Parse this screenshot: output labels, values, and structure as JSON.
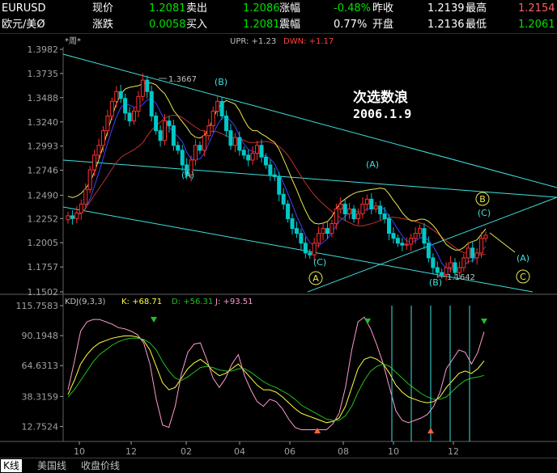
{
  "quote": {
    "symbol": "EURUSD",
    "name": "欧元/美Ø",
    "row1": [
      {
        "label": "现价",
        "value": "1.2081"
      },
      {
        "label": "卖出",
        "value": "1.2086"
      },
      {
        "label": "涨幅",
        "value": "-0.48%"
      },
      {
        "label": "昨收",
        "value": "1.2139"
      },
      {
        "label": "最高",
        "value": "1.2154"
      }
    ],
    "row2": [
      {
        "label": "涨跌",
        "value": "0.0058"
      },
      {
        "label": "买入",
        "value": "1.2081"
      },
      {
        "label": "震幅",
        "value": "0.77%"
      },
      {
        "label": "开盘",
        "value": "1.2136"
      },
      {
        "label": "最低",
        "value": "1.2061"
      }
    ]
  },
  "price_panel": {
    "indicator_text": "*周*",
    "upr_label": "UPR: +1.23",
    "dn_label": "DWN: +1.17",
    "y_ticks": [
      "1.3982",
      "1.3735",
      "1.3488",
      "1.3240",
      "1.2993",
      "1.2746",
      "1.2490",
      "1.2252",
      "1.2005",
      "1.1757",
      "1.1502"
    ],
    "high_note": "1.3667",
    "low_note": "1.1642",
    "title_cn": "次选数浪",
    "title_date": "2006.1.9",
    "waves": [
      "(B)",
      "(A)",
      "(A)",
      "(C)",
      "(C)",
      "(B)",
      "(A)",
      "A",
      "B",
      "C"
    ]
  },
  "kdj_panel": {
    "label": "KDJ(9,3,3)",
    "k_label": "K: +68.71",
    "d_label": "D: +56.31",
    "j_label": "J: +93.51",
    "y_ticks": [
      "115.7583",
      "90.1948",
      "64.6313",
      "38.3159",
      "12.7524"
    ]
  },
  "x_ticks": [
    "10",
    "12",
    "02",
    "04",
    "06",
    "08",
    "10",
    "12"
  ],
  "tabs": [
    "K线",
    "美国线",
    "收盘价线"
  ],
  "colors": {
    "up": "#ff3030",
    "down": "#00c8c8",
    "ma1": "#e8e850",
    "ma2": "#4040ff",
    "ma3": "#c03030",
    "trend": "#40e0e0",
    "k": "#ffff40",
    "d": "#20c020",
    "j": "#ff9ad0",
    "axis": "#a0a0a0"
  },
  "chart_data": [
    {
      "type": "candlestick",
      "title": "次选数浪 2006.1.9",
      "ylim": [
        1.1502,
        1.3982
      ],
      "closes": [
        1.228,
        1.2252,
        1.231,
        1.24,
        1.255,
        1.275,
        1.29,
        1.3,
        1.315,
        1.33,
        1.345,
        1.355,
        1.348,
        1.333,
        1.325,
        1.335,
        1.35,
        1.3667,
        1.355,
        1.33,
        1.315,
        1.305,
        1.325,
        1.32,
        1.3,
        1.295,
        1.28,
        1.27,
        1.285,
        1.3,
        1.295,
        1.31,
        1.32,
        1.335,
        1.345,
        1.33,
        1.315,
        1.3,
        1.308,
        1.295,
        1.29,
        1.285,
        1.292,
        1.3,
        1.288,
        1.28,
        1.27,
        1.268,
        1.25,
        1.24,
        1.225,
        1.215,
        1.21,
        1.2,
        1.19,
        1.188,
        1.2,
        1.21,
        1.215,
        1.21,
        1.22,
        1.235,
        1.24,
        1.23,
        1.235,
        1.225,
        1.23,
        1.24,
        1.245,
        1.235,
        1.238,
        1.23,
        1.225,
        1.21,
        1.205,
        1.2,
        1.198,
        1.199,
        1.205,
        1.21,
        1.215,
        1.2,
        1.185,
        1.175,
        1.17,
        1.168,
        1.175,
        1.18,
        1.17,
        1.175,
        1.185,
        1.195,
        1.185,
        1.19,
        1.205,
        1.2081
      ],
      "notes": {
        "high": 1.3667,
        "low": 1.1642
      }
    },
    {
      "type": "line",
      "title": "KDJ(9,3,3)",
      "ylim": [
        0,
        115.7583
      ],
      "series": [
        {
          "name": "K",
          "values": [
            40,
            52,
            66,
            74,
            80,
            84,
            86,
            88,
            89,
            90,
            90,
            89,
            86,
            78,
            64,
            50,
            44,
            46,
            54,
            62,
            67,
            70,
            66,
            60,
            56,
            58,
            62,
            66,
            60,
            54,
            48,
            44,
            44,
            42,
            38,
            33,
            28,
            24,
            22,
            20,
            18,
            16,
            17,
            20,
            30,
            46,
            62,
            70,
            72,
            70,
            66,
            58,
            48,
            42,
            38,
            36,
            34,
            33,
            34,
            38,
            46,
            52,
            58,
            60,
            58,
            62,
            68.71
          ]
        },
        {
          "name": "D",
          "values": [
            38,
            44,
            52,
            60,
            68,
            74,
            78,
            82,
            85,
            87,
            88,
            88,
            87,
            84,
            78,
            68,
            60,
            54,
            52,
            55,
            59,
            63,
            64,
            63,
            61,
            60,
            60,
            62,
            62,
            59,
            55,
            51,
            48,
            46,
            43,
            40,
            36,
            31,
            28,
            25,
            22,
            19,
            18,
            18,
            22,
            30,
            42,
            52,
            60,
            64,
            66,
            64,
            59,
            54,
            49,
            45,
            41,
            38,
            36,
            36,
            38,
            43,
            48,
            52,
            54,
            55,
            56.31
          ]
        },
        {
          "name": "J",
          "values": [
            44,
            68,
            94,
            102,
            104,
            104,
            102,
            100,
            97,
            96,
            94,
            91,
            84,
            66,
            36,
            14,
            12,
            30,
            58,
            76,
            83,
            84,
            70,
            54,
            46,
            54,
            66,
            74,
            56,
            44,
            34,
            30,
            36,
            34,
            28,
            19,
            12,
            10,
            10,
            10,
            10,
            10,
            15,
            24,
            46,
            78,
            102,
            106,
            96,
            82,
            66,
            46,
            26,
            18,
            16,
            18,
            20,
            23,
            30,
            42,
            62,
            70,
            78,
            76,
            66,
            76,
            93.51
          ]
        }
      ]
    }
  ]
}
